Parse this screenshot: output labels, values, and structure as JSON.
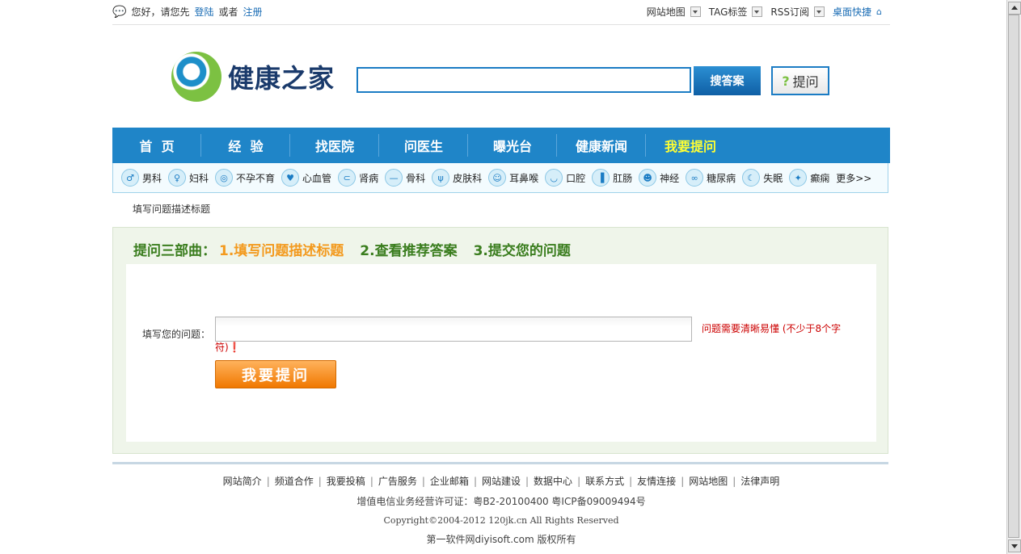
{
  "topbar": {
    "greeting": "您好，请您先",
    "login": "登陆",
    "or": "或者",
    "register": "注册",
    "sitemap": "网站地图",
    "tags": "TAG标签",
    "rss": "RSS订阅",
    "shortcut": "桌面快捷"
  },
  "header": {
    "logo_text": "健康之家",
    "search_placeholder": "",
    "search_button": "搜答案",
    "ask_button": "提问",
    "ask_icon": "?"
  },
  "nav": {
    "items": [
      "首  页",
      "经  验",
      "找医院",
      "问医生",
      "曝光台",
      "健康新闻",
      "我要提问"
    ]
  },
  "categories": {
    "items": [
      {
        "label": "男科",
        "icon": "♂"
      },
      {
        "label": "妇科",
        "icon": "♀"
      },
      {
        "label": "不孕不育",
        "icon": "◎"
      },
      {
        "label": "心血管",
        "icon": "♥"
      },
      {
        "label": "肾病",
        "icon": "⊂"
      },
      {
        "label": "骨科",
        "icon": "—"
      },
      {
        "label": "皮肤科",
        "icon": "ψ"
      },
      {
        "label": "耳鼻喉",
        "icon": "☺"
      },
      {
        "label": "口腔",
        "icon": "◡"
      },
      {
        "label": "肛肠",
        "icon": "▐"
      },
      {
        "label": "神经",
        "icon": "☻"
      },
      {
        "label": "糖尿病",
        "icon": "∞"
      },
      {
        "label": "失眠",
        "icon": "☾"
      },
      {
        "label": "癫痫",
        "icon": "✦"
      }
    ],
    "more": "更多>>"
  },
  "breadcrumb": "填写问题描述标题",
  "steps": {
    "prefix": "提问三部曲：",
    "step1": "1.填写问题描述标题",
    "step2": "2.查看推荐答案",
    "step3": "3.提交您的问题"
  },
  "form": {
    "label": "填写您的问题：",
    "value": "",
    "hint_line1": "问题需要清晰易懂 (不少于8个字",
    "hint_line2": "符)❗",
    "submit": "我要提问"
  },
  "footer": {
    "links": [
      "网站简介",
      "频道合作",
      "我要投稿",
      "广告服务",
      "企业邮箱",
      "网站建设",
      "数据中心",
      "联系方式",
      "友情连接",
      "网站地图",
      "法律声明"
    ],
    "license": "增值电信业务经营许可证：粤B2-20100400  粤ICP备09009494号",
    "copyright": "Copyright©2004-2012 120jk.cn All Rights Reserved",
    "credit": "第一软件网diyisoft.com 版权所有"
  }
}
